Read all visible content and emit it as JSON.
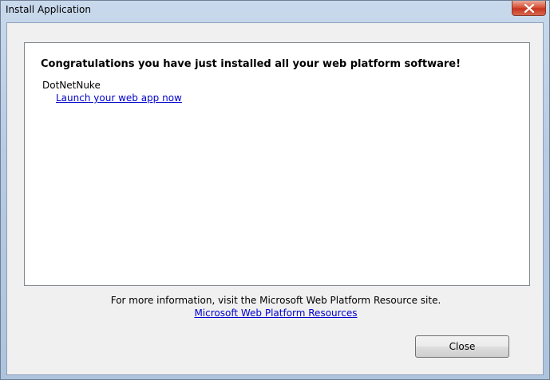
{
  "window": {
    "title": "Install Application"
  },
  "panel": {
    "heading": "Congratulations you have just installed all your web platform software!",
    "app_name": "DotNetNuke",
    "app_link": "Launch your web app now"
  },
  "footer": {
    "info_text": "For more information, visit the Microsoft Web Platform Resource site.",
    "info_link": "Microsoft Web Platform Resources",
    "close_label": "Close"
  },
  "icons": {
    "close": "close-icon"
  }
}
